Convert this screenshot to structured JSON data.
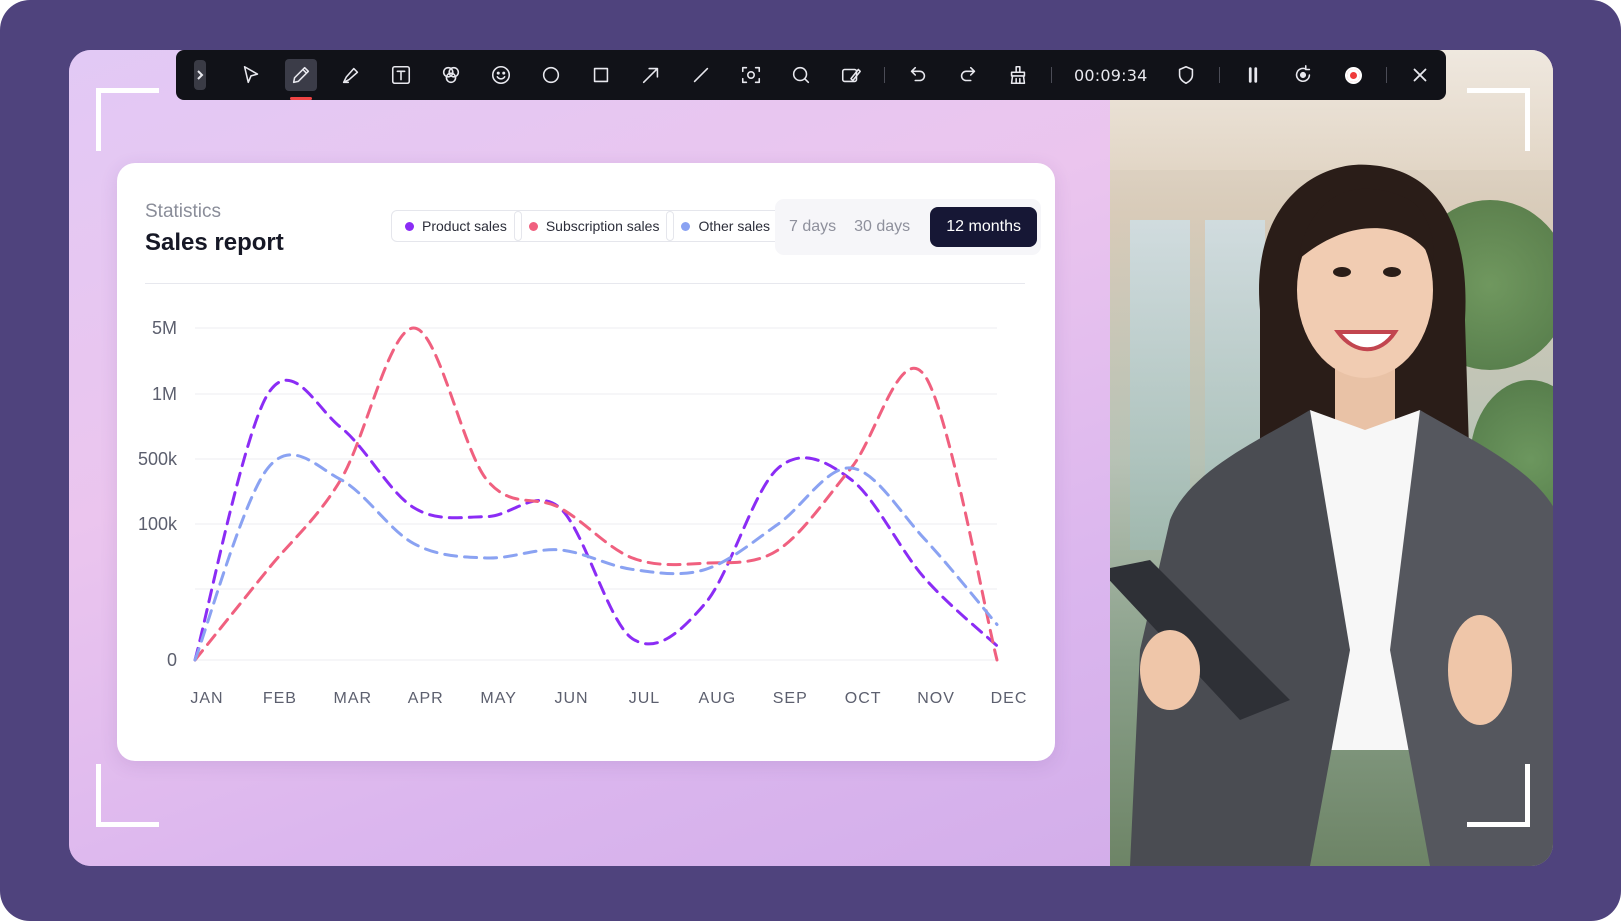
{
  "toolbar": {
    "timer": "00:09:34",
    "tools": [
      "expand",
      "select",
      "pen",
      "highlighter",
      "text",
      "shapes",
      "emoji",
      "circle",
      "rectangle",
      "arrow",
      "line",
      "screenshot",
      "zoom",
      "whiteboard",
      "undo",
      "redo",
      "clear",
      "hide",
      "pause",
      "restart",
      "record",
      "close"
    ]
  },
  "card": {
    "subtitle": "Statistics",
    "title": "Sales report",
    "legend": [
      {
        "label": "Product sales",
        "color": "#8b2cf5"
      },
      {
        "label": "Subscription sales",
        "color": "#f0607f"
      },
      {
        "label": "Other sales",
        "color": "#8aa2f2"
      }
    ],
    "periods": [
      "7 days",
      "30 days",
      "12 months"
    ],
    "active_period": "12 months"
  },
  "chart_data": {
    "type": "line",
    "categories": [
      "JAN",
      "FEB",
      "MAR",
      "APR",
      "MAY",
      "JUN",
      "JUL",
      "AUG",
      "SEP",
      "OCT",
      "NOV",
      "DEC"
    ],
    "y_ticks": [
      "5M",
      "1M",
      "500k",
      "100k",
      "",
      "0"
    ],
    "grid": true,
    "style": "dashed smooth lines",
    "series": [
      {
        "name": "Product sales",
        "color": "#8b2cf5",
        "values": [
          0,
          1000000,
          700000,
          150000,
          120000,
          150000,
          3000,
          8000,
          400000,
          300000,
          15000,
          2000
        ]
      },
      {
        "name": "Subscription sales",
        "color": "#f0607f",
        "values": [
          0,
          20000,
          300000,
          5000000,
          300000,
          150000,
          30000,
          25000,
          40000,
          400000,
          1600000,
          0
        ]
      },
      {
        "name": "Other sales",
        "color": "#8aa2f2",
        "values": [
          0,
          400000,
          300000,
          50000,
          30000,
          40000,
          20000,
          20000,
          100000,
          400000,
          60000,
          5000
        ]
      }
    ]
  }
}
